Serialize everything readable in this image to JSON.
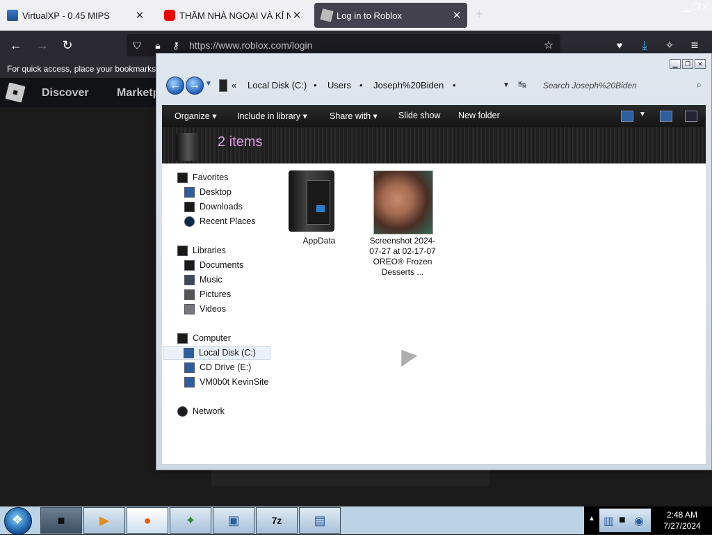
{
  "browser": {
    "tabs": [
      {
        "title": "VirtualXP - 0.45 MIPS",
        "icon": "virtualxp-icon",
        "close": "✕"
      },
      {
        "title": "THĂM NHÀ NGOẠI VÀ KỈ NIỆM",
        "icon": "youtube-icon",
        "close": "✕"
      },
      {
        "title": "Log in to Roblox",
        "icon": "roblox-icon",
        "close": "✕",
        "active": true
      }
    ],
    "new_tab": "+",
    "url": "https://www.roblox.com/login",
    "bookmarks_hint": "For quick access, place your bookmarks h"
  },
  "roblox": {
    "nav": [
      "Discover",
      "Marketp"
    ]
  },
  "explorer": {
    "breadcrumb": [
      "«",
      "Local Disk (C:)",
      "•",
      "Users",
      "•",
      "Joseph%20Biden",
      "•"
    ],
    "search_placeholder": "Search Joseph%20Biden",
    "toolbar": {
      "organize": "Organize",
      "include": "Include in library",
      "share": "Share with",
      "slideshow": "Slide show",
      "newfolder": "New folder"
    },
    "items_count": "2 items",
    "navpane": {
      "favorites": "Favorites",
      "desktop": "Desktop",
      "downloads": "Downloads",
      "recent": "Recent Places",
      "libraries": "Libraries",
      "documents": "Documents",
      "music": "Music",
      "pictures": "Pictures",
      "videos": "Videos",
      "computer": "Computer",
      "localdisk": "Local Disk (C:)",
      "cddrive": "CD Drive (E:)",
      "vm": "VM0b0t KevinSite",
      "network": "Network"
    },
    "files": [
      {
        "name": "AppData"
      },
      {
        "name": "Screenshot 2024-07-27 at 02-17-07 OREO® Frozen Desserts ..."
      }
    ]
  },
  "taskbar": {
    "time": "2:48 AM",
    "date": "7/27/2024"
  }
}
